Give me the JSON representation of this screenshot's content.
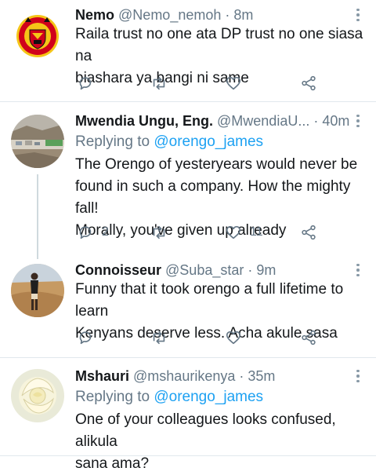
{
  "tweets": [
    {
      "name": "Nemo",
      "handle": "@Nemo_nemoh",
      "dot": "·",
      "time": "8m",
      "replying_label": "",
      "replying_handle": "",
      "text_lines": [
        "Raila trust no one ata DP trust no one siasa na",
        "biashara ya bangi ni same"
      ],
      "replies": "",
      "likes": "",
      "avatar": "manchester-united-crest"
    },
    {
      "name": "Mwendia Ungu, Eng.",
      "handle": "@MwendiaU...",
      "dot": "·",
      "time": "40m",
      "replying_label": "Replying to",
      "replying_handle": "@orengo_james",
      "text_lines": [
        "The Orengo of yesteryears would never be",
        "found in such a company. How the mighty fall!",
        "Morally, you've given up already"
      ],
      "replies": "2",
      "likes": "11",
      "avatar": "landscape-photo"
    },
    {
      "name": "Connoisseur",
      "handle": "@Suba_star",
      "dot": "·",
      "time": "9m",
      "replying_label": "",
      "replying_handle": "",
      "text_lines": [
        "Funny that it took orengo a full lifetime to learn",
        "Kenyans deserve less. Acha akule sasa"
      ],
      "replies": "",
      "likes": "",
      "avatar": "person-in-desert-photo"
    },
    {
      "name": "Mshauri",
      "handle": "@mshaurikenya",
      "dot": "·",
      "time": "35m",
      "replying_label": "Replying to",
      "replying_handle": "@orengo_james",
      "text_lines": [
        "One of your colleagues looks confused, alikula",
        "sana ama?"
      ],
      "replies": "",
      "likes": "",
      "avatar": "white-rose-photo"
    }
  ],
  "colors": {
    "text": "#14171a",
    "secondary": "#657786",
    "link": "#1da1f2",
    "divider": "#e1e8ed",
    "thread": "#cfd9de"
  }
}
